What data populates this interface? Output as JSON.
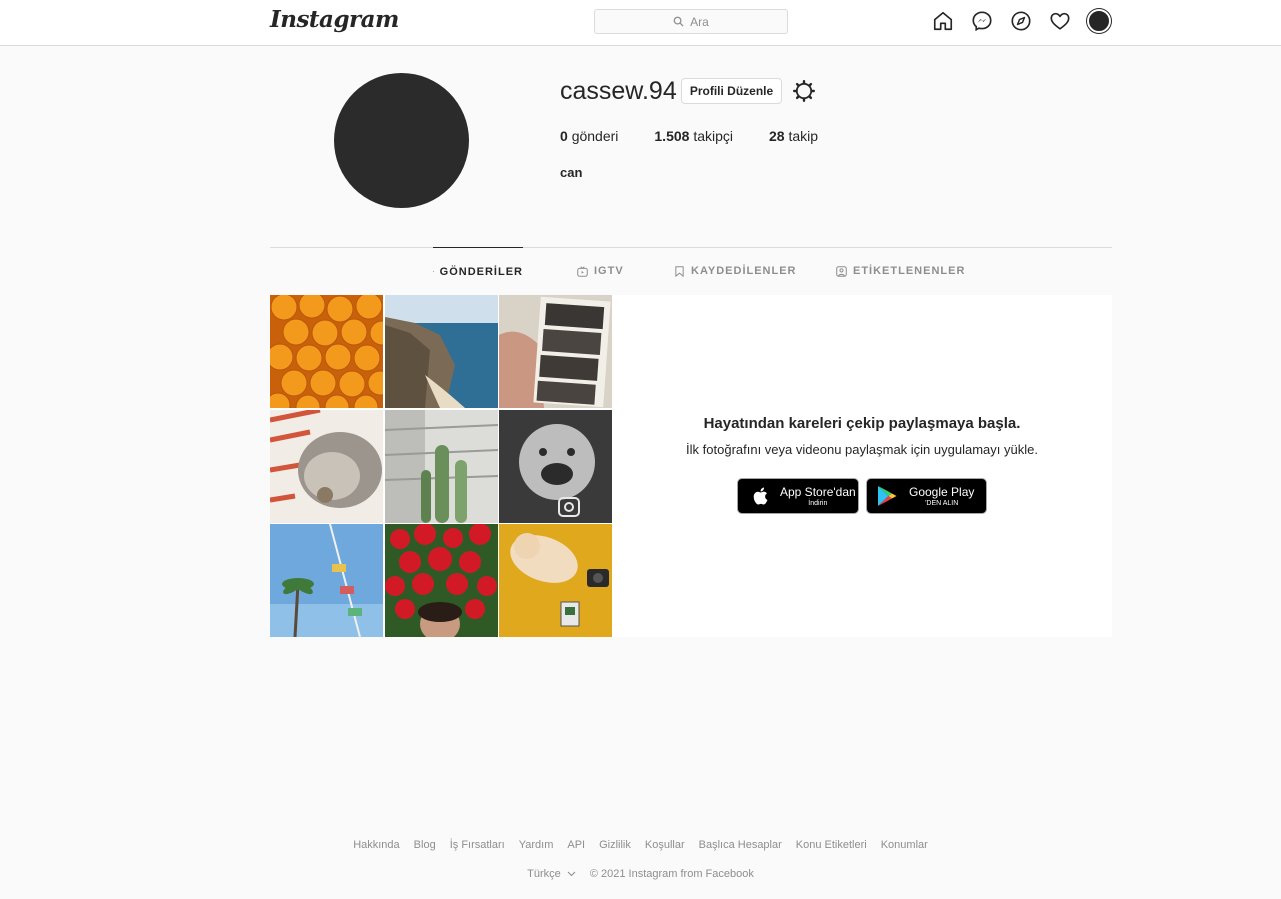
{
  "header": {
    "logo_text": "Instagram",
    "search_placeholder": "Ara",
    "icons": [
      "home-icon",
      "messenger-icon",
      "explore-icon",
      "activity-heart-icon",
      "profile-avatar"
    ]
  },
  "profile": {
    "username": "cassew.94",
    "edit_button": "Profili Düzenle",
    "stats": [
      {
        "count": "0",
        "label": "gönderi"
      },
      {
        "count": "1.508",
        "label": "takipçi"
      },
      {
        "count": "28",
        "label": "takip"
      }
    ],
    "full_name": "can"
  },
  "tabs": [
    {
      "label": "GÖNDERİLER",
      "icon": "grid-icon",
      "active": true
    },
    {
      "label": "IGTV",
      "icon": "igtv-icon",
      "active": false
    },
    {
      "label": "KAYDEDİLENLER",
      "icon": "bookmark-icon",
      "active": false
    },
    {
      "label": "ETİKETLENENLER",
      "icon": "tagged-icon",
      "active": false
    }
  ],
  "empty_state": {
    "title": "Hayatından kareleri çekip paylaşmaya başla.",
    "subtitle": "İlk fotoğrafını veya videonu paylaşmak için uygulamayı yükle.",
    "app_store": {
      "line1": "App Store'dan",
      "line2": "İndirin"
    },
    "google_play": {
      "line1": "Google Play",
      "line2": "'DEN ALIN"
    }
  },
  "footer": {
    "links": [
      "Hakkında",
      "Blog",
      "İş Fırsatları",
      "Yardım",
      "API",
      "Gizlilik",
      "Koşullar",
      "Başlıca Hesaplar",
      "Konu Etiketleri",
      "Konumlar"
    ],
    "language": "Türkçe",
    "copyright": "© 2021 Instagram from Facebook"
  },
  "colors": {
    "background": "#fafafa",
    "border": "#dbdbdb",
    "text": "#262626",
    "muted": "#8e8e8e"
  }
}
